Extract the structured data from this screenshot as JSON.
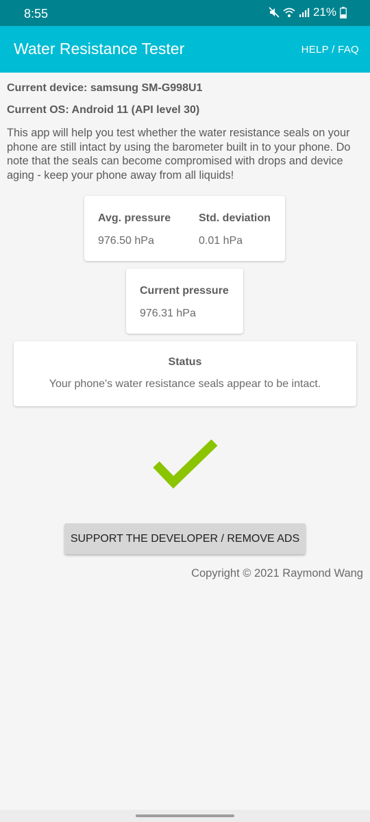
{
  "status_bar": {
    "time": "8:55",
    "battery": "21%",
    "icons": [
      "mute-icon",
      "wifi-icon",
      "signal-icon",
      "battery-icon"
    ]
  },
  "app_bar": {
    "title": "Water Resistance Tester",
    "help": "HELP / FAQ",
    "color": "#00bcd4",
    "status_color": "#00838f"
  },
  "device": {
    "current_device": "Current device: samsung SM-G998U1",
    "current_os": "Current OS: Android 11 (API level 30)"
  },
  "description": "This app will help you test whether the water resistance seals on your phone are still intact by using the barometer built in to your phone. Do note that the seals can become compromised with drops and device aging - keep your phone away from all liquids!",
  "stats": {
    "avg_label": "Avg. pressure",
    "avg_value": "976.50 hPa",
    "std_label": "Std. deviation",
    "std_value": "0.01 hPa",
    "current_label": "Current pressure",
    "current_value": "976.31 hPa"
  },
  "status": {
    "title": "Status",
    "text": "Your phone's water resistance seals appear to be intact.",
    "icon": "checkmark-icon",
    "icon_color": "#8bc400"
  },
  "support_button": "SUPPORT THE DEVELOPER / REMOVE ADS",
  "copyright": "Copyright © 2021 Raymond Wang"
}
